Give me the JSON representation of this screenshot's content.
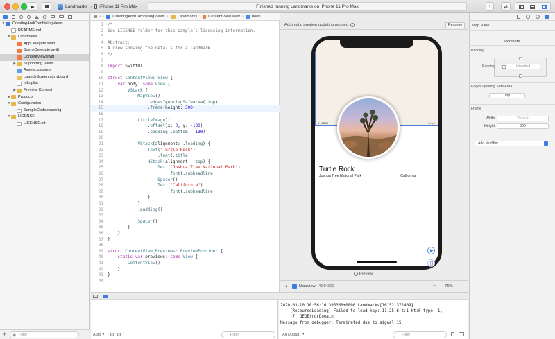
{
  "toolbar": {
    "scheme_target": "Landmarks",
    "scheme_device": "iPhone 11 Pro Max",
    "activity_status": "Finished running Landmarks on iPhone 11 Pro Max",
    "plus_icon": "+",
    "layout_icons": [
      "⇄",
      "□"
    ]
  },
  "navigator": {
    "filter_placeholder": "Filter",
    "tree": [
      {
        "label": "CreatingAndCombiningViews",
        "indent": 0,
        "icon": "proj",
        "disc": "▼",
        "selected": false
      },
      {
        "label": "README.md",
        "indent": 1,
        "icon": "doc",
        "disc": "",
        "selected": false
      },
      {
        "label": "Landmarks",
        "indent": 1,
        "icon": "folder",
        "disc": "▼",
        "selected": false
      },
      {
        "label": "AppDelegate.swift",
        "indent": 2,
        "icon": "swift",
        "disc": "",
        "selected": false
      },
      {
        "label": "SceneDelegate.swift",
        "indent": 2,
        "icon": "swift",
        "disc": "",
        "selected": false
      },
      {
        "label": "ContentView.swift",
        "indent": 2,
        "icon": "swift",
        "disc": "",
        "selected": true
      },
      {
        "label": "Supporting Views",
        "indent": 2,
        "icon": "folder",
        "disc": "▶",
        "selected": false
      },
      {
        "label": "Assets.xcassets",
        "indent": 2,
        "icon": "assets",
        "disc": "",
        "selected": false
      },
      {
        "label": "LaunchScreen.storyboard",
        "indent": 2,
        "icon": "story",
        "disc": "",
        "selected": false
      },
      {
        "label": "Info.plist",
        "indent": 2,
        "icon": "doc",
        "disc": "",
        "selected": false
      },
      {
        "label": "Preview Content",
        "indent": 2,
        "icon": "folder",
        "disc": "▶",
        "selected": false
      },
      {
        "label": "Products",
        "indent": 1,
        "icon": "folder",
        "disc": "▶",
        "selected": false
      },
      {
        "label": "Configuration",
        "indent": 1,
        "icon": "folder",
        "disc": "▼",
        "selected": false
      },
      {
        "label": "SampleCode.xcconfig",
        "indent": 2,
        "icon": "doc",
        "disc": "",
        "selected": false
      },
      {
        "label": "LICENSE",
        "indent": 1,
        "icon": "folder",
        "disc": "▼",
        "selected": false
      },
      {
        "label": "LICENSE.txt",
        "indent": 2,
        "icon": "doc",
        "disc": "",
        "selected": false
      }
    ]
  },
  "jumpbar": {
    "crumbs": [
      "CreatingAndCombiningViews",
      "Landmarks",
      "ContentView.swift",
      "body"
    ]
  },
  "editor": {
    "highlight_line": 15,
    "lines": [
      [
        {
          "t": "/*",
          "c": "c"
        }
      ],
      [
        {
          "t": "See LICENSE folder for this sample’s licensing information.",
          "c": "c"
        }
      ],
      [],
      [
        {
          "t": "Abstract:",
          "c": "c"
        }
      ],
      [
        {
          "t": "A view showing the details for a landmark.",
          "c": "c"
        }
      ],
      [
        {
          "t": "*/",
          "c": "c"
        }
      ],
      [],
      [
        {
          "t": "import",
          "c": "k"
        },
        {
          "t": " SwiftUI",
          "c": ""
        }
      ],
      [],
      [
        {
          "t": "struct",
          "c": "k"
        },
        {
          "t": " ContentView",
          "c": "t"
        },
        {
          "t": ": ",
          "c": ""
        },
        {
          "t": "View",
          "c": "t"
        },
        {
          "t": " {",
          "c": ""
        }
      ],
      [
        {
          "t": "    ",
          "c": ""
        },
        {
          "t": "var",
          "c": "k"
        },
        {
          "t": " body",
          "c": ""
        },
        {
          "t": ": ",
          "c": ""
        },
        {
          "t": "some",
          "c": "k"
        },
        {
          "t": " View",
          "c": "t"
        },
        {
          "t": " {",
          "c": ""
        }
      ],
      [
        {
          "t": "        VStack",
          "c": "t"
        },
        {
          "t": " {",
          "c": ""
        }
      ],
      [
        {
          "t": "            MapView",
          "c": "t"
        },
        {
          "t": "()",
          "c": ""
        }
      ],
      [
        {
          "t": "                .",
          "c": ""
        },
        {
          "t": "edgesIgnoringSafeArea",
          "c": "f"
        },
        {
          "t": "(.",
          "c": ""
        },
        {
          "t": "top",
          "c": "f"
        },
        {
          "t": ")",
          "c": ""
        }
      ],
      [
        {
          "t": "                .",
          "c": ""
        },
        {
          "t": "frame",
          "c": "f"
        },
        {
          "t": "(height: ",
          "c": ""
        },
        {
          "t": "300",
          "c": "n"
        },
        {
          "t": ")",
          "c": ""
        }
      ],
      [],
      [
        {
          "t": "            CircleImage",
          "c": "t"
        },
        {
          "t": "()",
          "c": ""
        }
      ],
      [
        {
          "t": "                .",
          "c": ""
        },
        {
          "t": "offset",
          "c": "f"
        },
        {
          "t": "(x: ",
          "c": ""
        },
        {
          "t": "0",
          "c": "n"
        },
        {
          "t": ", y: ",
          "c": ""
        },
        {
          "t": "-130",
          "c": "n"
        },
        {
          "t": ")",
          "c": ""
        }
      ],
      [
        {
          "t": "                .",
          "c": ""
        },
        {
          "t": "padding",
          "c": "f"
        },
        {
          "t": "(.",
          "c": ""
        },
        {
          "t": "bottom",
          "c": "f"
        },
        {
          "t": ", ",
          "c": ""
        },
        {
          "t": "-130",
          "c": "n"
        },
        {
          "t": ")",
          "c": ""
        }
      ],
      [],
      [
        {
          "t": "            VStack",
          "c": "t"
        },
        {
          "t": "(alignment: .",
          "c": ""
        },
        {
          "t": "leading",
          "c": "f"
        },
        {
          "t": ") {",
          "c": ""
        }
      ],
      [
        {
          "t": "                Text",
          "c": "t"
        },
        {
          "t": "(",
          "c": ""
        },
        {
          "t": "\"Turtle Rock\"",
          "c": "s"
        },
        {
          "t": ")",
          "c": ""
        }
      ],
      [
        {
          "t": "                    .",
          "c": ""
        },
        {
          "t": "font",
          "c": "f"
        },
        {
          "t": "(.",
          "c": ""
        },
        {
          "t": "title",
          "c": "f"
        },
        {
          "t": ")",
          "c": ""
        }
      ],
      [
        {
          "t": "                HStack",
          "c": "t"
        },
        {
          "t": "(alignment: .",
          "c": ""
        },
        {
          "t": "top",
          "c": "f"
        },
        {
          "t": ") {",
          "c": ""
        }
      ],
      [
        {
          "t": "                    Text",
          "c": "t"
        },
        {
          "t": "(",
          "c": ""
        },
        {
          "t": "\"Joshua Tree National Park\"",
          "c": "s"
        },
        {
          "t": ")",
          "c": ""
        }
      ],
      [
        {
          "t": "                        .",
          "c": ""
        },
        {
          "t": "font",
          "c": "f"
        },
        {
          "t": "(.",
          "c": ""
        },
        {
          "t": "subheadline",
          "c": "f"
        },
        {
          "t": ")",
          "c": ""
        }
      ],
      [
        {
          "t": "                    Spacer",
          "c": "t"
        },
        {
          "t": "()",
          "c": ""
        }
      ],
      [
        {
          "t": "                    Text",
          "c": "t"
        },
        {
          "t": "(",
          "c": ""
        },
        {
          "t": "\"California\"",
          "c": "s"
        },
        {
          "t": ")",
          "c": ""
        }
      ],
      [
        {
          "t": "                        .",
          "c": ""
        },
        {
          "t": "font",
          "c": "f"
        },
        {
          "t": "(.",
          "c": ""
        },
        {
          "t": "subheadline",
          "c": "f"
        },
        {
          "t": ")",
          "c": ""
        }
      ],
      [
        {
          "t": "                }",
          "c": ""
        }
      ],
      [
        {
          "t": "            }",
          "c": ""
        }
      ],
      [
        {
          "t": "            .",
          "c": ""
        },
        {
          "t": "padding",
          "c": "f"
        },
        {
          "t": "()",
          "c": ""
        }
      ],
      [],
      [
        {
          "t": "            Spacer",
          "c": "t"
        },
        {
          "t": "()",
          "c": ""
        }
      ],
      [
        {
          "t": "        }",
          "c": ""
        }
      ],
      [
        {
          "t": "    }",
          "c": ""
        }
      ],
      [
        {
          "t": "}",
          "c": ""
        }
      ],
      [],
      [
        {
          "t": "struct",
          "c": "k"
        },
        {
          "t": " ContentView_Previews",
          "c": "t"
        },
        {
          "t": ": ",
          "c": ""
        },
        {
          "t": "PreviewProvider",
          "c": "t"
        },
        {
          "t": " {",
          "c": ""
        }
      ],
      [
        {
          "t": "    ",
          "c": ""
        },
        {
          "t": "static",
          "c": "k"
        },
        {
          "t": " ",
          "c": ""
        },
        {
          "t": "var",
          "c": "k"
        },
        {
          "t": " previews: ",
          "c": ""
        },
        {
          "t": "some",
          "c": "k"
        },
        {
          "t": " View",
          "c": "t"
        },
        {
          "t": " {",
          "c": ""
        }
      ],
      [
        {
          "t": "        ContentView",
          "c": "t"
        },
        {
          "t": "()",
          "c": ""
        }
      ],
      [
        {
          "t": "    }",
          "c": ""
        }
      ],
      [
        {
          "t": "}",
          "c": ""
        }
      ],
      []
    ]
  },
  "canvas": {
    "status": "Automatic preview updating paused",
    "resume_label": "Resume",
    "preview_label": "Preview",
    "maps_label": "Maps",
    "legal_label": "Legal",
    "footer_view": "MapView",
    "footer_size": "414×300",
    "zoom": "76%",
    "minus": "−",
    "plus": "+"
  },
  "preview": {
    "title": "Turtle Rock",
    "park": "Joshua Tree National Park",
    "state": "California"
  },
  "inspector": {
    "header": "Map View",
    "modifiers_title": "Modifiers",
    "padding_section": "Padding",
    "padding_label": "Padding",
    "padding_value": "Inherited",
    "edges_section": "Edges Ignoring Safe Area",
    "edges_value": "Top",
    "frame_section": "Frame",
    "width_label": "Width",
    "width_value": "Default",
    "height_label": "Height",
    "height_value": "300",
    "add_modifier": "Add Modifier"
  },
  "debug": {
    "auto_label": "Auto",
    "filter_placeholder": "Filter",
    "output_label": "All Output",
    "console_filter_placeholder": "Filter",
    "console_lines": [
      "2020-03-10 10:56:16.395360+0800 Landmarks[16152:372409]",
      "    [ResourceLoading] Failed to load key: 11.25.6 t:1 kt:0 type: 1,",
      "    -7: GEOErrorDomain",
      "Message from debugger: Terminated due to signal 15"
    ]
  },
  "colors": {
    "selection": "#d3d3d3",
    "keyword": "#a42da8",
    "type": "#3b7c8c",
    "string": "#c41a16",
    "number": "#1c00cf",
    "accent": "#4c7bd8"
  }
}
